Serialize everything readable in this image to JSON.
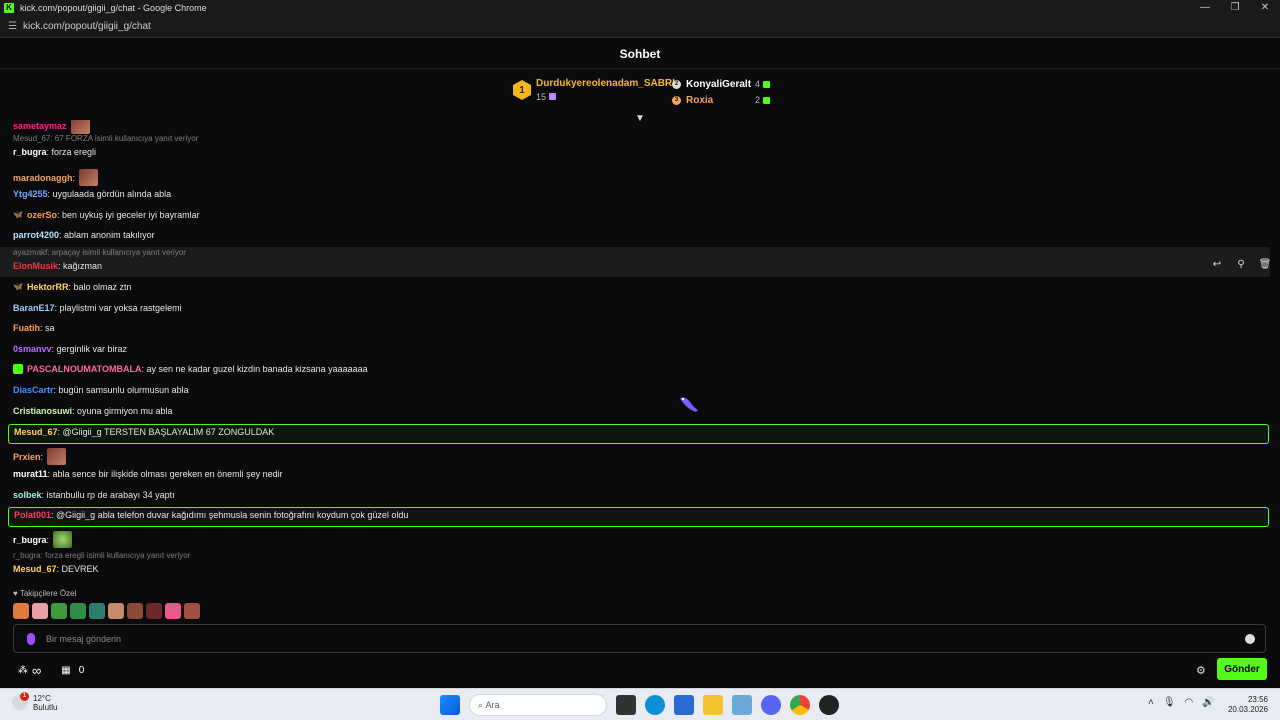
{
  "window": {
    "title": "kick.com/popout/giigii_g/chat - Google Chrome",
    "url": "kick.com/popout/giigii_g/chat",
    "controls": [
      "—",
      "❐",
      "✕"
    ]
  },
  "header": {
    "title": "Sohbet"
  },
  "leaderboard": {
    "first": {
      "rank": "1",
      "name": "Durdukyereolenadam_SABRI",
      "count": "15"
    },
    "others": [
      {
        "name": "KonyaliGeralt",
        "count": "4",
        "color": "#ffffff"
      },
      {
        "name": "Roxia",
        "count": "2",
        "color": "#f4a261"
      }
    ]
  },
  "chat": {
    "messages": [
      {
        "user": "sametaymaz",
        "text": "",
        "color": "#f72585",
        "emote": true
      },
      {
        "reply": "Mesud_67: 67 FORZA isimli kullanıcıya yanıt veriyor"
      },
      {
        "user": "r_bugra",
        "text": ": forza eregli",
        "color": "#ffffff"
      },
      {
        "user": "maradonaggh",
        "text": ":",
        "color": "#f4a261",
        "emote": true
      },
      {
        "user": "Ytg4255",
        "text": ": uygulaada gördün alında abla",
        "color": "#6fa8ff"
      },
      {
        "user": "ozerSo",
        "text": ": ben uykuş iyi geceler iyi bayramlar",
        "color": "#ff9f43",
        "badge": "🦋"
      },
      {
        "user": "parrot4200",
        "text": ": ablam anonim takılıyor",
        "color": "#b8e0ff"
      },
      {
        "reply": "ayazmakf: arpaçay isimli kullanıcıya yanıt veriyor"
      },
      {
        "user": "ElonMusik",
        "text": ": kağızman",
        "color": "#e63946"
      },
      {
        "user": "HektorRR",
        "text": ": balo olmaz ztn",
        "color": "#ffd166",
        "badge": "🦋"
      },
      {
        "user": "BaranE17",
        "text": ": playlistmi var yoksa rastgelemi",
        "color": "#9ecbff"
      },
      {
        "user": "Fuatih",
        "text": ": sa",
        "color": "#ff9f43"
      },
      {
        "user": "0smanvv",
        "text": ": gerginlik var biraz",
        "color": "#b86bff"
      },
      {
        "user": "PASCALNOUMATOMBALA",
        "text": ": ay sen ne kadar guzel kizdin banada kizsana yaaaaaaa",
        "color": "#ff6b9a",
        "badge": "gift"
      },
      {
        "user": "DiasCartr",
        "text": ": bugün samsunlu olurmusun abla",
        "color": "#4c8dff"
      },
      {
        "user": "Cristianosuwi",
        "text": ": oyuna girmiyon mu abla",
        "color": "#c8f7a0"
      },
      {
        "user": "Mesud_67",
        "text": ": @Giigii_g TERSTEN BAŞLAYALIM 67 ZONGULDAK",
        "color": "#ffd166",
        "highlight": true
      },
      {
        "user": "Prxien",
        "text": ":",
        "color": "#f4a261",
        "emote": true
      },
      {
        "user": "murat11",
        "text": ": abla sence bir ilişkide olması gereken en önemli şey nedir",
        "color": "#ffffff"
      },
      {
        "user": "solbek",
        "text": ": istanbullu rp de arabayı 34 yaptı",
        "color": "#9ef0e0"
      },
      {
        "user": "Polat001",
        "text": ": @Giigii_g abla telefon duvar kağıdımı şehmusla senin fotoğrafını koydum çok güzel oldu",
        "color": "#ff3b5c",
        "highlight": true
      },
      {
        "user": "r_bugra",
        "text": ":",
        "color": "#ffffff",
        "emote": true
      },
      {
        "reply": "r_bugra: forza eregli isimli kullanıcıya yanıt veriyor"
      },
      {
        "user": "Mesud_67",
        "text": ": DEVREK",
        "color": "#ffd166"
      }
    ]
  },
  "followers_only": {
    "label": "Takipçilere Özel"
  },
  "composer": {
    "placeholder": "Bir mesaj gönderin"
  },
  "bottom": {
    "points": "∞",
    "store_count": "0",
    "send_label": "Gönder"
  },
  "taskbar": {
    "weather": {
      "temp": "12°C",
      "desc": "Bulutlu",
      "badge": "1"
    },
    "search_placeholder": "Ara",
    "time": "23:56",
    "date": "20.03.2026"
  }
}
